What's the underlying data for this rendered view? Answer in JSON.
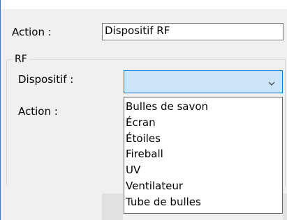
{
  "form": {
    "action_label": "Action :",
    "action_value": "Dispositif RF"
  },
  "group": {
    "title": "RF",
    "device_label": "Dispositif :",
    "action_label": "Action :",
    "device_selected_value": "",
    "options": [
      "Bulles de savon",
      "Écran",
      "Étoiles",
      "Fireball",
      "UV",
      "Ventilateur",
      "Tube de bulles"
    ]
  },
  "icons": {
    "dropdown": "chevron-down-icon"
  },
  "colors": {
    "combo_focus_fill": "#cce4f7",
    "combo_focus_border": "#0078d7",
    "dialog_background": "#f0f0f0",
    "window_border": "#3c78c8"
  }
}
